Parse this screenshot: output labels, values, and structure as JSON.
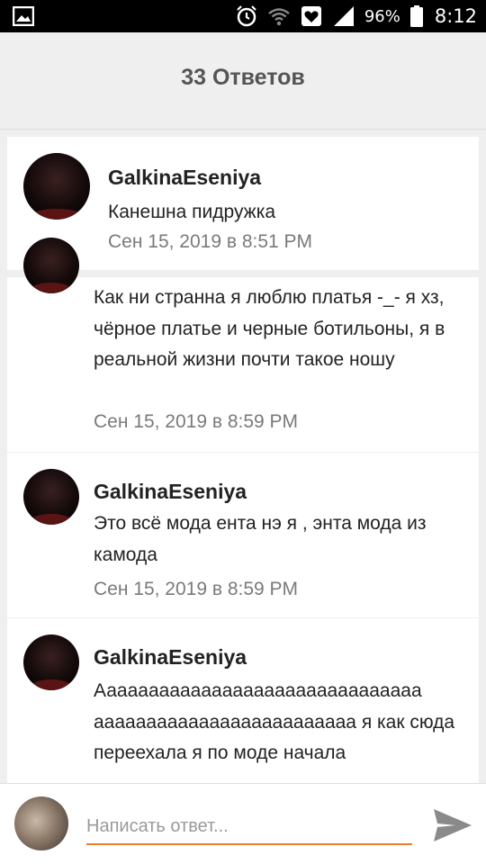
{
  "status_bar": {
    "battery": "96%",
    "time": "8:12",
    "icons": [
      "gallery-icon",
      "alarm-icon",
      "wifi-icon",
      "heart-notification-icon",
      "signal-icon",
      "battery-icon"
    ]
  },
  "header": {
    "title": "33 Ответов"
  },
  "comments": [
    {
      "author": "GalkinaEseniya",
      "text": "Канешна пидружка",
      "date": "Сен 15, 2019 в 8:51 PM"
    },
    {
      "author": "",
      "text": "Как ни странна я люблю платья -_- я хз, чёрное платье и черные ботильоны, я в реальной жизни почти такое ношу",
      "date": "Сен 15, 2019 в 8:59 PM"
    },
    {
      "author": "GalkinaEseniya",
      "text": "Это всё мода ента нэ я , энта мода из камода",
      "date": "Сен 15, 2019 в 8:59 PM"
    },
    {
      "author": "GalkinaEseniya",
      "text": "Ааааааааааааааааааааааааааааааа ааааааааааааааааааааааааа я как сюда переехала я по моде начала",
      "date": ""
    }
  ],
  "reply": {
    "placeholder": "Написать ответ..."
  },
  "colors": {
    "accent": "#ef7b2e",
    "header_bg": "#efefef",
    "status_bar_bg": "#000000"
  }
}
